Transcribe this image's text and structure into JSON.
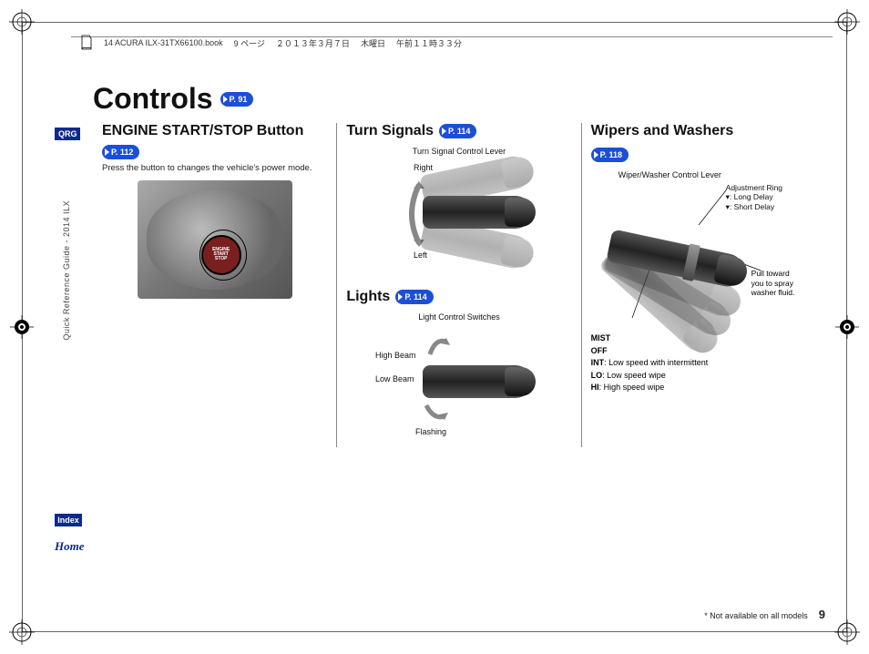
{
  "header": {
    "filename": "14 ACURA ILX-31TX66100.book",
    "pageinfo": "9 ページ",
    "date": "２０１３年３月７日",
    "weekday": "木曜日",
    "time": "午前１１時３３分"
  },
  "sidebar": {
    "qrg": "QRG",
    "vertical": "Quick Reference Guide - 2014 ILX",
    "index": "Index",
    "home": "Home"
  },
  "title": {
    "text": "Controls",
    "pref": "P. 91"
  },
  "col1": {
    "heading": "ENGINE START/STOP Button",
    "pref": "P. 112",
    "body": "Press the button to changes the vehicle's power mode.",
    "btn_l1": "ENGINE",
    "btn_l2": "START",
    "btn_l3": "STOP"
  },
  "col2": {
    "sec1": {
      "heading": "Turn Signals",
      "pref": "P. 114",
      "caption": "Turn Signal Control Lever",
      "lbl_right": "Right",
      "lbl_left": "Left"
    },
    "sec2": {
      "heading": "Lights",
      "pref": "P. 114",
      "caption": "Light Control Switches",
      "lbl_high": "High Beam",
      "lbl_low": "Low Beam",
      "lbl_flash": "Flashing"
    }
  },
  "col3": {
    "heading": "Wipers and Washers",
    "pref": "P. 118",
    "caption": "Wiper/Washer Control Lever",
    "annot_ring": "Adjustment Ring",
    "annot_long": ": Long Delay",
    "annot_short": ": Short Delay",
    "annot_pull": "Pull toward you to spray washer fluid.",
    "modes": {
      "mist": "MIST",
      "off": "OFF",
      "int_b": "INT",
      "int_t": ": Low speed with intermittent",
      "lo_b": "LO",
      "lo_t": ": Low speed wipe",
      "hi_b": "HI",
      "hi_t": ": High speed wipe"
    }
  },
  "footer": {
    "note": "* Not available on all models",
    "page": "9"
  }
}
